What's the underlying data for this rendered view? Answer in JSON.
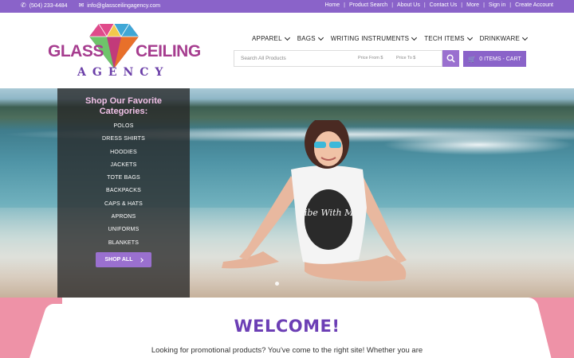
{
  "topbar": {
    "phone": "(504) 233-4484",
    "email": "info@glassceilingagency.com",
    "links": [
      "Home",
      "Product Search",
      "About Us",
      "Contact Us",
      "More",
      "Sign in",
      "Create Account"
    ]
  },
  "logo": {
    "word1": "GLASS",
    "word2": "CEILING",
    "word3": "AGENCY"
  },
  "nav": {
    "items": [
      {
        "label": "APPAREL"
      },
      {
        "label": "BAGS"
      },
      {
        "label": "WRITING INSTRUMENTS"
      },
      {
        "label": "TECH ITEMS"
      },
      {
        "label": "DRINKWARE"
      }
    ]
  },
  "search": {
    "placeholder": "Search All Products",
    "price_from": "Price From $",
    "price_to": "Price To $"
  },
  "cart": {
    "label": "0 ITEMS - CART"
  },
  "categories": {
    "title_line1": "Shop Our Favorite",
    "title_line2": "Categories:",
    "items": [
      "POLOS",
      "DRESS SHIRTS",
      "HOODIES",
      "JACKETS",
      "TOTE BAGS",
      "BACKPACKS",
      "CAPS & HATS",
      "APRONS",
      "UNIFORMS",
      "BLANKETS"
    ],
    "shop_all": "SHOP ALL"
  },
  "hero": {
    "shirt_text": "Vibe With Me"
  },
  "welcome": {
    "heading": "WELCOME!",
    "lead": "Looking for promotional products? You've come to the right site! Whether you are"
  },
  "colors": {
    "brand_purple": "#8a63c9",
    "accent_pink": "#ee92a7",
    "heading_purple": "#6c3fb5"
  }
}
